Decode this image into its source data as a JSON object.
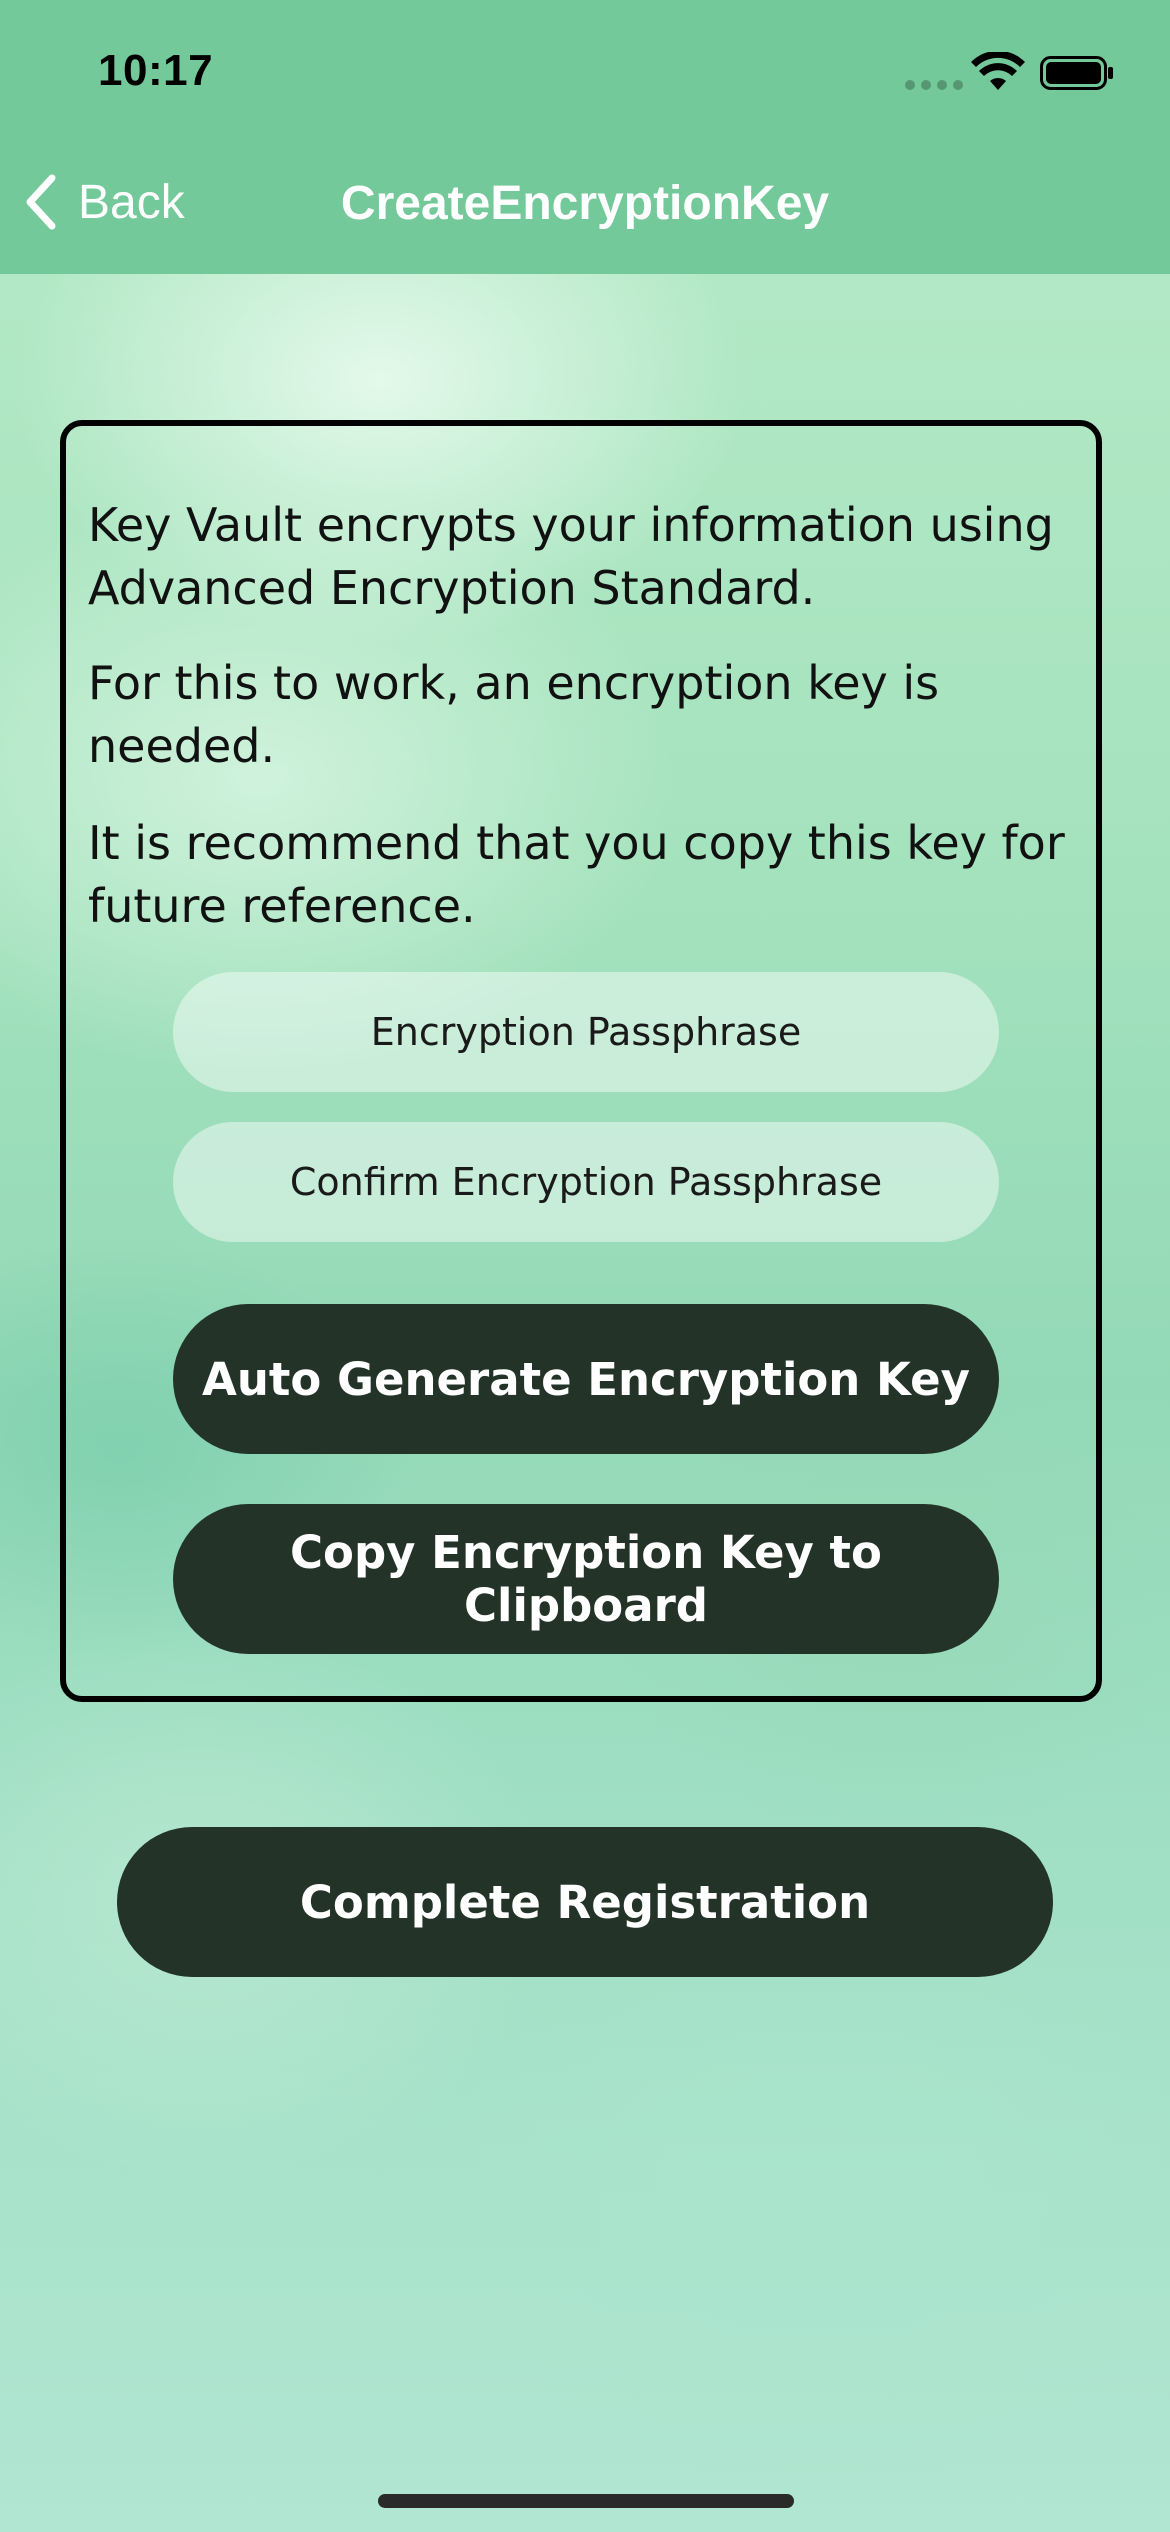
{
  "status_bar": {
    "time": "10:17"
  },
  "nav": {
    "back_label": "Back",
    "title": "CreateEncryptionKey"
  },
  "card": {
    "paragraphs": [
      "Key Vault encrypts your information using Advanced Encryption Standard.",
      "For this to work, an encryption key is needed.",
      "It is recommend that you copy this key for future reference."
    ],
    "passphrase_placeholder": "Encryption Passphrase",
    "confirm_placeholder": "Confirm Encryption Passphrase",
    "auto_generate_label": "Auto Generate Encryption Key",
    "copy_label": "Copy Encryption Key to Clipboard"
  },
  "complete_label": "Complete Registration",
  "colors": {
    "header": "#74c99a",
    "button": "#233328",
    "button_text": "#ffffff",
    "background": "#a4e2bd"
  }
}
